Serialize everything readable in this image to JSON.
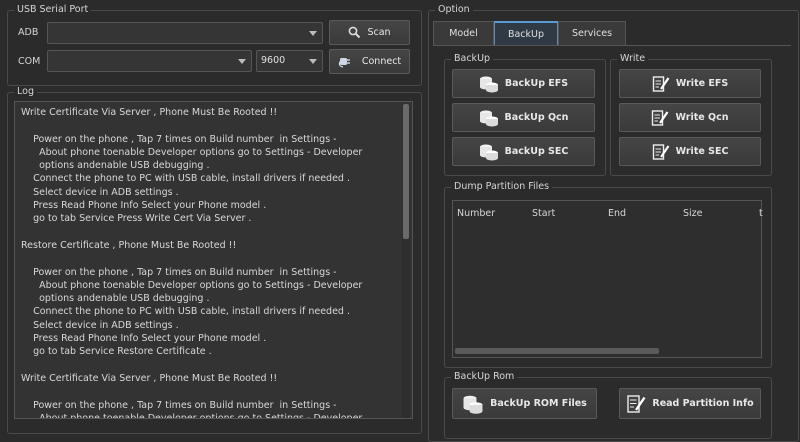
{
  "usb_serial_port": {
    "title": "USB Serial Port",
    "adb_label": "ADB",
    "adb_value": "",
    "com_label": "COM",
    "com_value": "",
    "baud_value": "9600",
    "scan_label": "Scan",
    "connect_label": "Connect"
  },
  "log": {
    "title": "Log",
    "lines": [
      "Write Certificate Via Server , Phone Must Be Rooted !!",
      "",
      "    Power on the phone , Tap 7 times on Build number  in Settings -",
      "      About phone toenable Developer options go to Settings - Developer",
      "      options andenable USB debugging .",
      "    Connect the phone to PC with USB cable, install drivers if needed .",
      "    Select device in ADB settings .",
      "    Press Read Phone Info Select your Phone model .",
      "    go to tab Service Press Write Cert Via Server .",
      "",
      "Restore Certificate , Phone Must Be Rooted !!",
      "",
      "    Power on the phone , Tap 7 times on Build number  in Settings -",
      "      About phone toenable Developer options go to Settings - Developer",
      "      options andenable USB debugging .",
      "    Connect the phone to PC with USB cable, install drivers if needed .",
      "    Select device in ADB settings .",
      "    Press Read Phone Info Select your Phone model .",
      "    go to tab Service Restore Certificate .",
      "",
      "Write Certificate Via Server , Phone Must Be Rooted !!",
      "",
      "    Power on the phone , Tap 7 times on Build number  in Settings -",
      "      About phone toenable Developer options go to Settings - Developer"
    ]
  },
  "option": {
    "title": "Option",
    "tabs": [
      {
        "label": "Model",
        "active": false
      },
      {
        "label": "BackUp",
        "active": true
      },
      {
        "label": "Services",
        "active": false
      }
    ],
    "backup_group": {
      "title": "BackUp",
      "buttons": [
        "BackUp EFS",
        "BackUp Qcn",
        "BackUp SEC"
      ]
    },
    "write_group": {
      "title": "Write",
      "buttons": [
        "Write EFS",
        "Write Qcn",
        "Write SEC"
      ]
    },
    "dump_group": {
      "title": "Dump Partition Files",
      "columns": [
        "Number",
        "Start",
        "End",
        "Size",
        "t"
      ]
    },
    "backup_rom_group": {
      "title": "BackUp Rom",
      "backup_rom_label": "BackUp ROM Files",
      "read_partition_label": "Read Partition Info"
    }
  },
  "icons": {
    "scan": "magnifier-icon",
    "connect": "plug-icon",
    "backup": "database-icon",
    "write": "document-pen-icon"
  }
}
